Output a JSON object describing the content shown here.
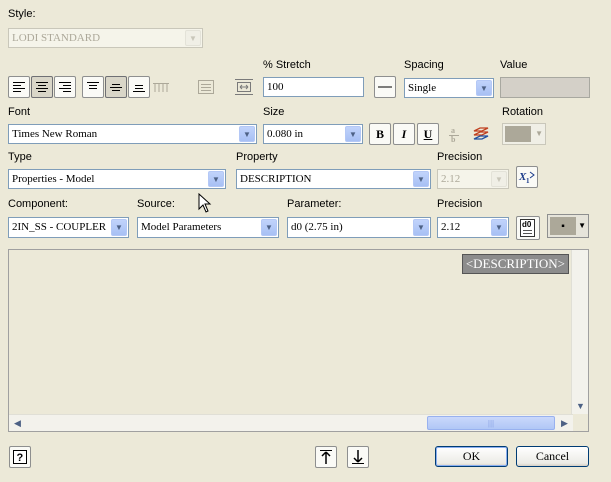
{
  "style": {
    "label": "Style:",
    "value": "LODI STANDARD"
  },
  "stretch": {
    "label": "% Stretch",
    "value": "100"
  },
  "spacing": {
    "label": "Spacing",
    "value": "Single"
  },
  "value_field": {
    "label": "Value",
    "value": ""
  },
  "font": {
    "label": "Font",
    "value": "Times New Roman"
  },
  "size": {
    "label": "Size",
    "value": "0.080 in"
  },
  "format": {
    "bold": "B",
    "italic": "I",
    "underline": "U"
  },
  "rotation": {
    "label": "Rotation"
  },
  "type": {
    "label": "Type",
    "value": "Properties - Model"
  },
  "property": {
    "label": "Property",
    "value": "DESCRIPTION"
  },
  "precision1": {
    "label": "Precision",
    "value": "2.12"
  },
  "component": {
    "label": "Component:",
    "value": "2IN_SS - COUPLER"
  },
  "source": {
    "label": "Source:",
    "value": "Model Parameters"
  },
  "parameter": {
    "label": "Parameter:",
    "value": "d0 (2.75 in)"
  },
  "precision2": {
    "label": "Precision",
    "value": "2.12"
  },
  "param_button_text": "d0",
  "editor": {
    "token": "<DESCRIPTION>"
  },
  "buttons": {
    "ok": "OK",
    "cancel": "Cancel"
  },
  "colors": {
    "background": "#ece9d8",
    "combo_border": "#7f9db9",
    "ok_border": "#003c74"
  }
}
